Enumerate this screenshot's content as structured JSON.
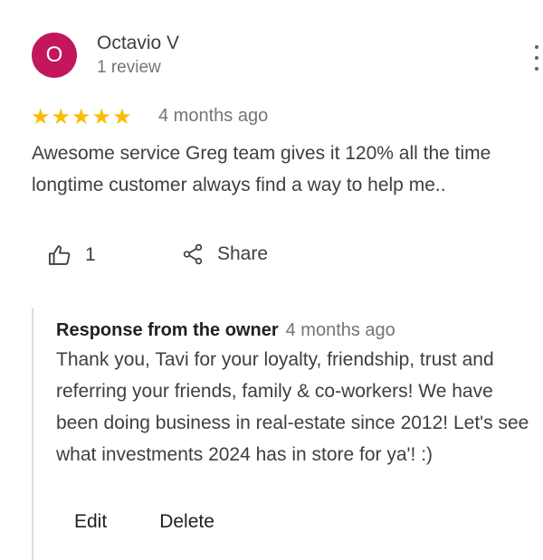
{
  "reviewer": {
    "avatar_letter": "O",
    "avatar_color": "#c2185b",
    "name": "Octavio V",
    "review_count": "1 review"
  },
  "review": {
    "rating": 5,
    "rating_max": 5,
    "star_color": "#fbbc04",
    "time": "4 months ago",
    "text": "Awesome service Greg team gives it 120% all the time longtime customer always find a way to help me.."
  },
  "actions": {
    "like_icon": "thumbs-up-icon",
    "like_count": "1",
    "share_icon": "share-icon",
    "share_label": "Share",
    "more_icon": "more-vert-icon"
  },
  "owner_response": {
    "title": "Response from the owner",
    "time": "4 months ago",
    "text": "Thank you, Tavi for your loyalty, friendship, trust and referring your friends, family & co-workers! We have been doing business in real-estate since 2012! Let's see what investments 2024 has in store for ya'! :)",
    "edit_label": "Edit",
    "delete_label": "Delete"
  }
}
